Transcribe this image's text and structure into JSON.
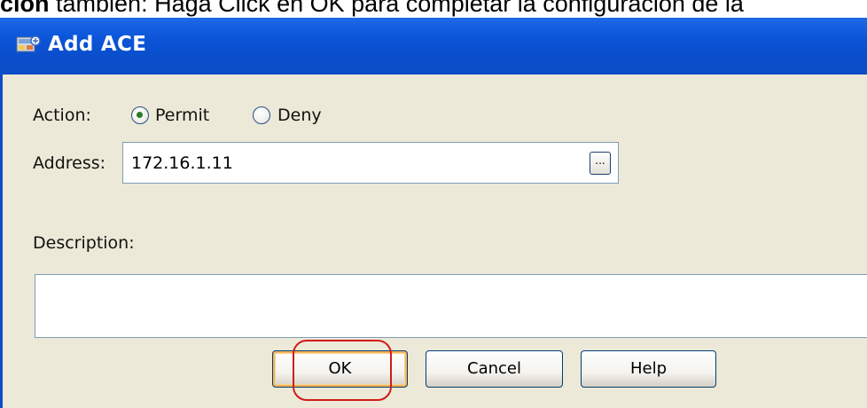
{
  "caption": {
    "bold_prefix": "ción",
    "text": " también: Haga Click en OK para completar la configuración de la"
  },
  "dialog": {
    "title": "Add ACE",
    "icon": "network-rule-icon"
  },
  "form": {
    "action_label": "Action:",
    "action_options": [
      {
        "label": "Permit",
        "selected": true
      },
      {
        "label": "Deny",
        "selected": false
      }
    ],
    "address_label": "Address:",
    "address_value": "172.16.1.11",
    "browse_label": "...",
    "description_label": "Description:",
    "description_value": ""
  },
  "buttons": {
    "ok": "OK",
    "cancel": "Cancel",
    "help": "Help"
  },
  "colors": {
    "titlebar": "#0b55d9",
    "dialog_background": "#ece9d8",
    "highlight_circle": "#d11a1a"
  }
}
